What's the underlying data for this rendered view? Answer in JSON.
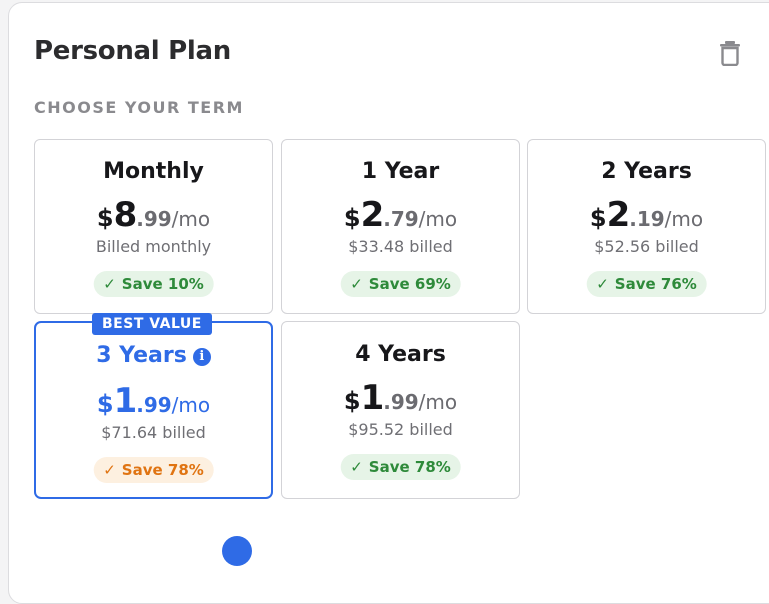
{
  "plan": {
    "title": "Personal Plan",
    "section_label": "CHOOSE YOUR TERM"
  },
  "icons": {
    "trash": "trash-icon",
    "check": "check-icon",
    "info": "info-icon"
  },
  "colors": {
    "accent": "#2f6be6",
    "green_text": "#2e8a3a",
    "green_bg": "#e6f4e7",
    "orange_text": "#e07412",
    "orange_bg": "#fdf0e0"
  },
  "terms": [
    {
      "name": "Monthly",
      "currency": "$",
      "whole": "8",
      "cents": ".99",
      "unit": "/mo",
      "billed": "Billed monthly",
      "save": "Save 10%",
      "selected": false
    },
    {
      "name": "1 Year",
      "currency": "$",
      "whole": "2",
      "cents": ".79",
      "unit": "/mo",
      "billed": "$33.48 billed",
      "save": "Save 69%",
      "selected": false
    },
    {
      "name": "2 Years",
      "currency": "$",
      "whole": "2",
      "cents": ".19",
      "unit": "/mo",
      "billed": "$52.56 billed",
      "save": "Save 76%",
      "selected": false
    },
    {
      "name": "3 Years",
      "currency": "$",
      "whole": "1",
      "cents": ".99",
      "unit": "/mo",
      "billed": "$71.64 billed",
      "save": "Save 78%",
      "selected": true,
      "ribbon": "BEST VALUE",
      "info_glyph": "i"
    },
    {
      "name": "4 Years",
      "currency": "$",
      "whole": "1",
      "cents": ".99",
      "unit": "/mo",
      "billed": "$95.52 billed",
      "save": "Save 78%",
      "selected": false
    }
  ],
  "check_glyph": "✓"
}
